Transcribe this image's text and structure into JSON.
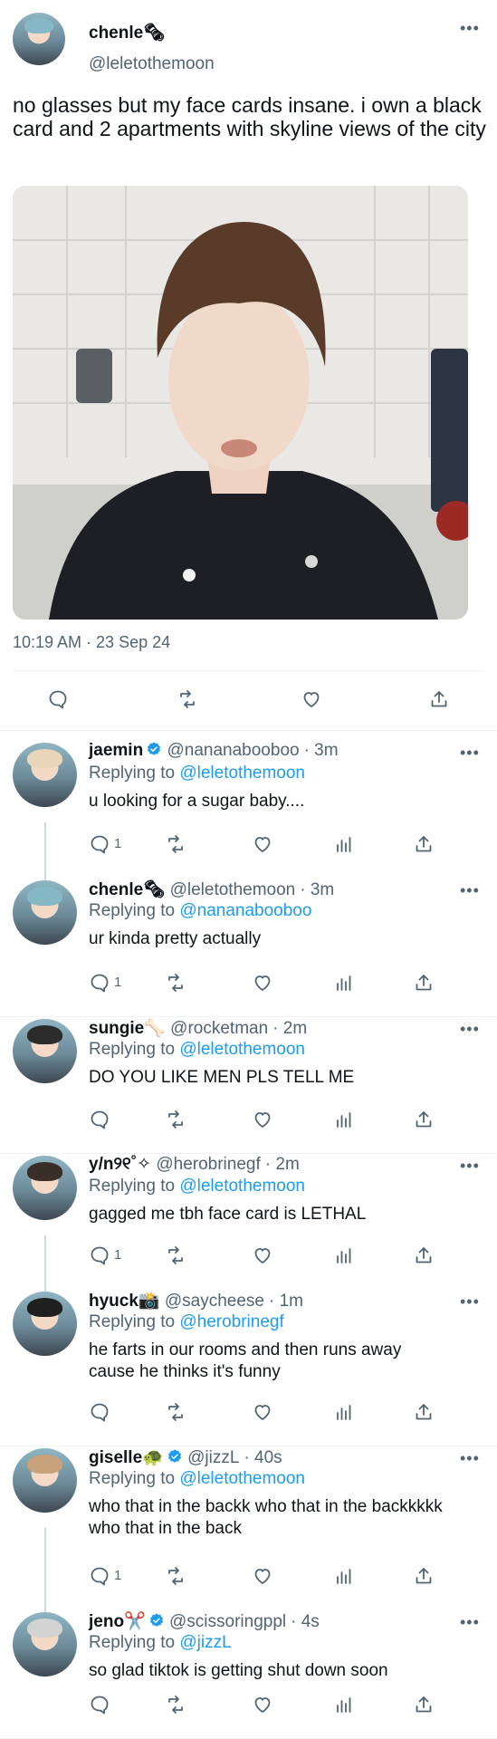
{
  "main_tweet": {
    "name": "chenle🗞",
    "handle": "@leletothemoon",
    "text": "no glasses but my face cards insane. i own a black card and 2 apartments with skyline views of the city",
    "timestamp": "10:19 AM · 23 Sep 24"
  },
  "replies": [
    {
      "name": "jaemin",
      "verified": true,
      "handle": "@nananabooboo",
      "time": "· 3m",
      "replying_prefix": "Replying to",
      "replying_to": "@leletothemoon",
      "text": "u looking for a sugar baby....",
      "reply_count": "1"
    },
    {
      "name": "chenle🗞",
      "verified": false,
      "handle": "@leletothemoon",
      "time": "· 3m",
      "replying_prefix": "Replying to",
      "replying_to": "@nananabooboo",
      "text": "ur kinda pretty actually",
      "reply_count": "1"
    },
    {
      "name": "sungie🦴",
      "verified": false,
      "handle": "@rocketman",
      "time": "· 2m",
      "replying_prefix": "Replying to",
      "replying_to": "@leletothemoon",
      "text": "DO YOU LIKE MEN PLS TELL ME",
      "reply_count": ""
    },
    {
      "name": "y/n୨୧˚✧",
      "verified": false,
      "handle": "@herobrinegf",
      "time": "· 2m",
      "replying_prefix": "Replying to",
      "replying_to": "@leletothemoon",
      "text": "gagged me tbh face card is LETHAL",
      "reply_count": "1"
    },
    {
      "name": "hyuck📸",
      "verified": false,
      "handle": "@saycheese",
      "time": "· 1m",
      "replying_prefix": "Replying to",
      "replying_to": "@herobrinegf",
      "text": "he farts in our rooms and then runs away cause he thinks it's funny",
      "reply_count": ""
    },
    {
      "name": "giselle🐢",
      "verified": true,
      "handle": "@jizzL",
      "time": "· 40s",
      "replying_prefix": "Replying to",
      "replying_to": "@leletothemoon",
      "text": "who that in the backk who that in the backkkkk who that in the back",
      "reply_count": "1"
    },
    {
      "name": "jeno✂️",
      "verified": true,
      "handle": "@scissoringppl",
      "time": "· 4s",
      "replying_prefix": "Replying to",
      "replying_to": "@jizzL",
      "text": "so glad tiktok is getting shut down soon",
      "reply_count": ""
    }
  ],
  "icons": {
    "more": "more-icon",
    "reply": "reply-icon",
    "retweet": "retweet-icon",
    "like": "like-icon",
    "views": "views-icon",
    "share": "share-icon",
    "verified": "verified-badge-icon"
  },
  "colors": {
    "accent": "#1d9bf0",
    "muted": "#536471",
    "text": "#0f1419"
  }
}
